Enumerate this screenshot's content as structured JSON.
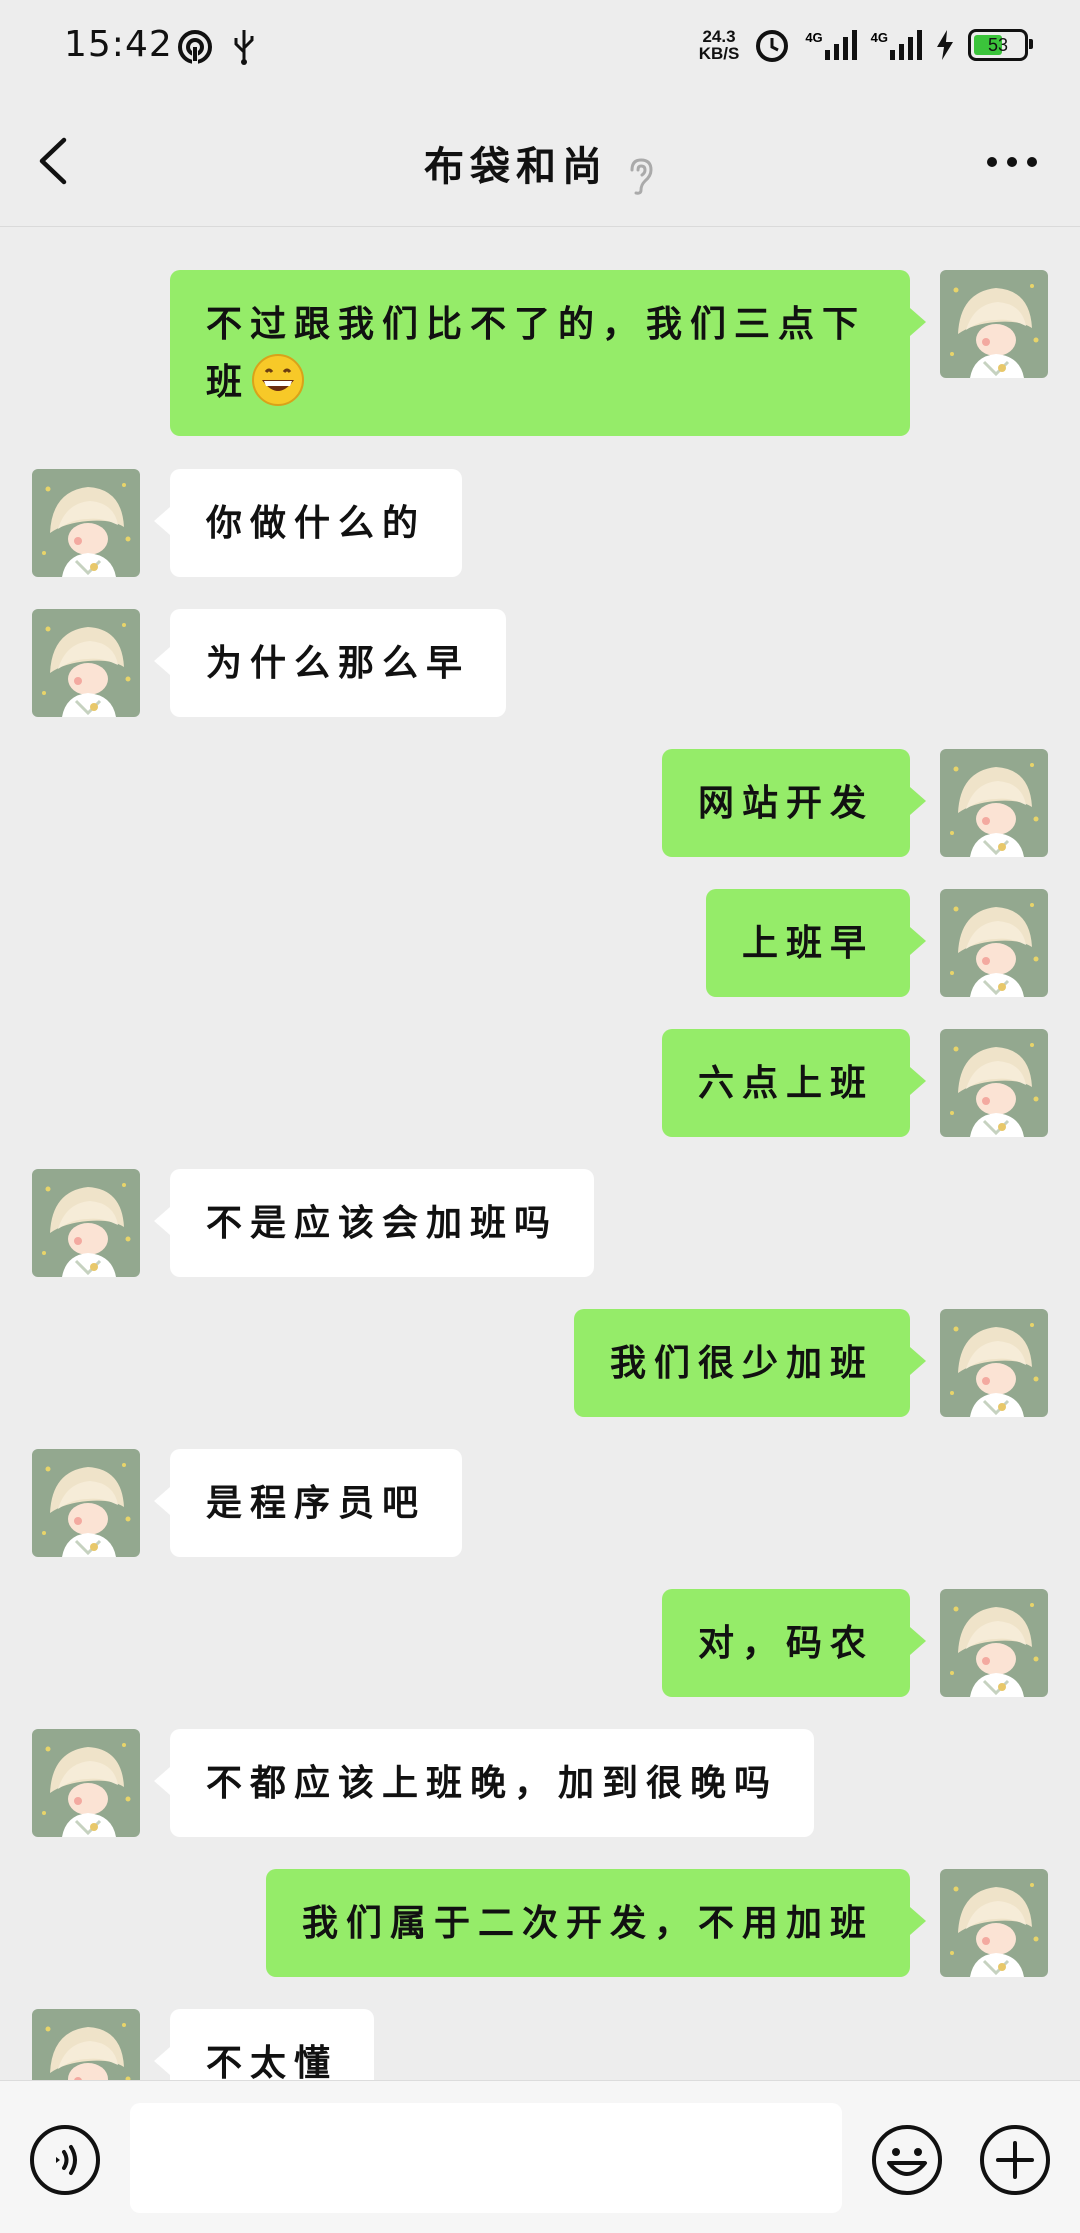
{
  "status_bar": {
    "time": "15:42",
    "speed_value": "24.3",
    "speed_unit": "KB/S",
    "net_type_1": "4G",
    "net_type_2": "4G",
    "battery_level": "53",
    "colors": {
      "battery_fill": "#3bc43b"
    },
    "icons": [
      "hotspot-icon",
      "usb-icon",
      "alarm-icon",
      "signal-icon",
      "signal-icon",
      "charging-icon",
      "battery-icon"
    ]
  },
  "header": {
    "title": "布袋和尚",
    "icons": [
      "back-arrow-icon",
      "earpiece-icon",
      "more-icon"
    ]
  },
  "messages": [
    {
      "side": "out",
      "text": "",
      "partial": true
    },
    {
      "side": "out",
      "text": "不过跟我们比不了的，我们三点下班",
      "emoji": "grinning-face-emoji"
    },
    {
      "side": "in",
      "text": "你做什么的"
    },
    {
      "side": "in",
      "text": "为什么那么早"
    },
    {
      "side": "out",
      "text": "网站开发"
    },
    {
      "side": "out",
      "text": "上班早"
    },
    {
      "side": "out",
      "text": "六点上班"
    },
    {
      "side": "in",
      "text": "不是应该会加班吗"
    },
    {
      "side": "out",
      "text": "我们很少加班"
    },
    {
      "side": "in",
      "text": "是程序员吧"
    },
    {
      "side": "out",
      "text": "对，码农"
    },
    {
      "side": "in",
      "text": "不都应该上班晚，加到很晚吗"
    },
    {
      "side": "out",
      "text": "我们属于二次开发，不用加班"
    },
    {
      "side": "in",
      "text": "不太懂"
    }
  ],
  "input_bar": {
    "placeholder": "",
    "value": "",
    "icons": [
      "voice-icon",
      "emoji-icon",
      "plus-icon"
    ]
  },
  "colors": {
    "background": "#ededed",
    "outgoing_bubble": "#95ec69",
    "incoming_bubble": "#ffffff"
  }
}
